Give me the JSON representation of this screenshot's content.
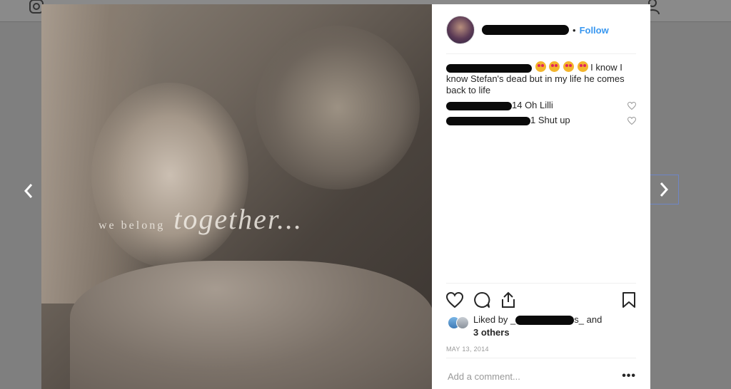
{
  "post": {
    "caption_small": "we belong",
    "caption_big": "together..."
  },
  "header": {
    "separator": "•",
    "follow_label": "Follow"
  },
  "comments": [
    {
      "text": "I know I know Stefan's dead but in my life he comes back to life",
      "emoji_count": 4
    },
    {
      "suffix": "14 Oh Lilli"
    },
    {
      "suffix": "1 Shut up"
    }
  ],
  "likes": {
    "prefix": "Liked by _",
    "suffix": "s_ and",
    "others": "3 others"
  },
  "date": "MAY 13, 2014",
  "add_comment": {
    "placeholder": "Add a comment..."
  },
  "more_label": "•••",
  "colors": {
    "accent": "#3897f0",
    "text": "#262626",
    "muted": "#999999"
  }
}
